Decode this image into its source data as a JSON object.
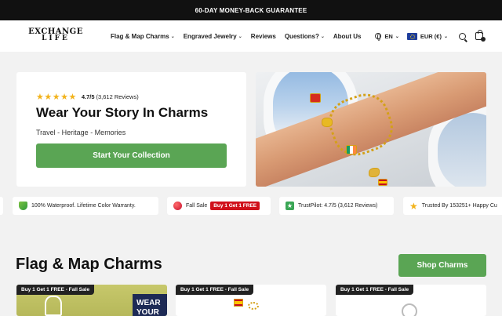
{
  "announcement": "60-DAY MONEY-BACK GUARANTEE",
  "logo": {
    "line1": "EXCHANGE",
    "line2": "LIFE"
  },
  "nav": {
    "items": [
      {
        "label": "Flag & Map Charms",
        "has_dropdown": true
      },
      {
        "label": "Engraved Jewelry",
        "has_dropdown": true
      },
      {
        "label": "Reviews",
        "has_dropdown": false
      },
      {
        "label": "Questions?",
        "has_dropdown": true
      },
      {
        "label": "About Us",
        "has_dropdown": false
      }
    ],
    "language": "EN",
    "currency": "EUR (€)",
    "icons": {
      "language": "globe-icon",
      "currency": "eu-flag-icon",
      "search": "search-icon",
      "cart": "bag-icon"
    }
  },
  "hero": {
    "rating_value": "4.7/5",
    "rating_count": "(3,612 Reviews)",
    "stars": "★★★★★",
    "title": "Wear Your Story In Charms",
    "subtitle": "Travel - Heritage - Memories",
    "cta_label": "Start Your Collection"
  },
  "features": [
    {
      "icon": "shield-icon",
      "text": "100% Waterproof. Lifetime Color Warranty."
    },
    {
      "icon": "ball-icon",
      "text": "Fall Sale",
      "badge": "Buy 1 Get 1 FREE"
    },
    {
      "icon": "trustpilot-icon",
      "text": "TrustPilot: 4.7/5 (3,612 Reviews)"
    },
    {
      "icon": "star-icon",
      "text": "Trusted By 153251+ Happy Cu"
    }
  ],
  "section": {
    "title": "Flag & Map Charms",
    "button_label": "Shop Charms"
  },
  "products": [
    {
      "badge": "Buy 1 Get 1 FREE - Fall Sale",
      "overlay_text": "WEAR YOUR"
    },
    {
      "badge": "Buy 1 Get 1 FREE - Fall Sale"
    },
    {
      "badge": "Buy 1 Get 1 FREE - Fall Sale"
    }
  ],
  "colors": {
    "accent_green": "#5aa554",
    "topbar": "#111111",
    "sale_red": "#d0111b",
    "star_gold": "#f2b31c"
  }
}
